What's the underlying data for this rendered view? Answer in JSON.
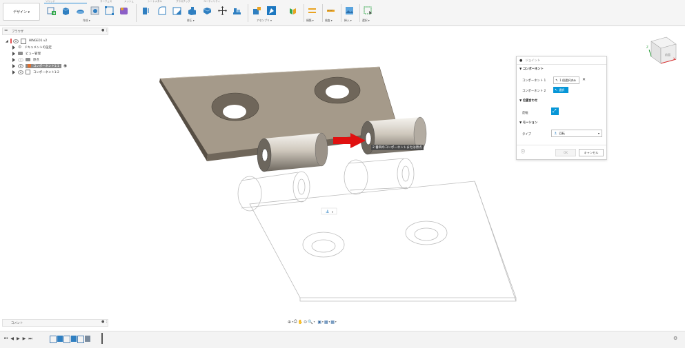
{
  "toolbar": {
    "design_label": "デザイン ▾",
    "tabs": [
      "ソリッド",
      "サーフェス",
      "メッシュ",
      "シートメタル",
      "プラスチック",
      "ユーティリティ"
    ],
    "groups": {
      "create": "作成 ▾",
      "modify": "修正 ▾",
      "assemble": "アセンブリ ▾",
      "construct": "構築 ▾",
      "inspect": "検査 ▾",
      "insert": "挿入 ▾",
      "select": "選択 ▾"
    }
  },
  "browser": {
    "title": "ブラウザ",
    "root": "HINGE01 v2",
    "items": [
      {
        "label": "ドキュメントの設定"
      },
      {
        "label": "ビュー管理"
      },
      {
        "label": "原点"
      },
      {
        "label": "コンポーネント1:1"
      },
      {
        "label": "コンポーネント1:2"
      }
    ]
  },
  "viewport": {
    "joint_label": "2 番目のコンポーネントまたは原点",
    "viewcube_label": "前面",
    "axis_x": "X",
    "axis_z": "Z"
  },
  "joint_dialog": {
    "title": "ジョイント",
    "section_component": "コンポーネント",
    "component1_label": "コンポーネント 1",
    "component1_value": "1 個選択済み",
    "component2_label": "コンポーネント 2",
    "component2_value": "選択",
    "section_alignment": "位置合わせ",
    "flip_label": "反転",
    "section_motion": "モーション",
    "type_label": "タイプ",
    "type_value": "回転",
    "ok_label": "OK",
    "cancel_label": "キャンセル"
  },
  "bottom": {
    "comment_label": "コメント"
  },
  "colors": {
    "accent": "#0696d7",
    "plate": "#a59a8a",
    "arrow": "#e01010"
  }
}
